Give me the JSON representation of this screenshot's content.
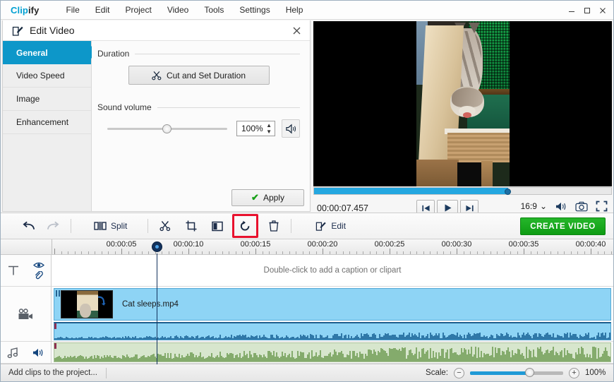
{
  "app": {
    "brand_first": "Clip",
    "brand_second": "ify",
    "menus": [
      "File",
      "Edit",
      "Project",
      "Video",
      "Tools",
      "Settings",
      "Help"
    ],
    "window_controls": {
      "minimize": "—",
      "maximize": "▢",
      "close": "✕"
    }
  },
  "edit_panel": {
    "title": "Edit Video",
    "close_label": "✕",
    "tabs": [
      {
        "label": "General",
        "active": true
      },
      {
        "label": "Video Speed",
        "active": false
      },
      {
        "label": "Image",
        "active": false
      },
      {
        "label": "Enhancement",
        "active": false
      }
    ],
    "duration": {
      "group_label": "Duration",
      "button_label": "Cut and Set Duration",
      "button_icon": "scissors-icon"
    },
    "sound": {
      "group_label": "Sound volume",
      "value": "100%",
      "slider_percent": 46,
      "mute_icon": "speaker-icon"
    },
    "apply_label": "Apply"
  },
  "preview": {
    "timecode": "00:00:07.457",
    "seek_percent": 65,
    "controls": [
      {
        "name": "skip-start-button",
        "icon": "skip-backward-icon"
      },
      {
        "name": "play-button",
        "icon": "play-icon"
      },
      {
        "name": "skip-end-button",
        "icon": "skip-forward-icon"
      }
    ],
    "aspect_ratio": "16:9",
    "aspect_caret": "⌄",
    "volume_icon": "speaker-icon",
    "snapshot_icon": "camera-icon",
    "fullscreen_icon": "fullscreen-icon"
  },
  "toolbar": {
    "undo_icon": "undo-arrow-icon",
    "redo_icon": "redo-arrow-icon",
    "split_label": "Split",
    "split_icon": "split-icon",
    "cut_icon": "scissors-icon",
    "crop_icon": "crop-icon",
    "flip_icon": "flip-icon",
    "rotate_icon": "rotate-clockwise-icon",
    "delete_icon": "trash-icon",
    "edit_label": "Edit",
    "edit_icon": "pencil-square-icon",
    "create_video_label": "CREATE VIDEO",
    "highlight_color": "#e8112d",
    "create_video_color": "#15a81a"
  },
  "timeline": {
    "ruler_labels": [
      "00:00:05",
      "00:00:10",
      "00:00:15",
      "00:00:20",
      "00:00:25",
      "00:00:30",
      "00:00:35",
      "00:00:40"
    ],
    "playhead_time": "00:00:07.457",
    "tracks": [
      {
        "name": "caption-track",
        "icons": [
          "text-icon",
          "eye-icon",
          "link-icon"
        ],
        "hint": "Double-click to add a caption or clipart"
      },
      {
        "name": "video-track",
        "icons": [
          "video-camera-icon"
        ],
        "clip_name": "Cat sleeps.mp4",
        "clip_badge_icon": "rotate-indicator-icon"
      },
      {
        "name": "music-track",
        "icons": [
          "music-note-icon",
          "speaker-icon"
        ]
      }
    ]
  },
  "status": {
    "text": "Add clips to the project...",
    "scale_label": "Scale:",
    "zoom_out_label": "−",
    "zoom_in_label": "+",
    "scale_value": "100%",
    "scale_percent": 60
  }
}
